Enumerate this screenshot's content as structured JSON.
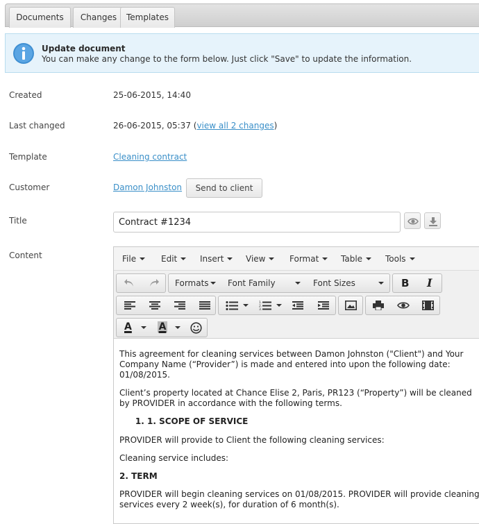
{
  "tabs": [
    {
      "label": "Documents"
    },
    {
      "label": "Changes"
    },
    {
      "label": "Templates"
    }
  ],
  "info": {
    "title": "Update document",
    "text": "You can make any change to the form below. Just click \"Save\" to update the information."
  },
  "fields": {
    "created_label": "Created",
    "created_value": "25-06-2015, 14:40",
    "last_changed_label": "Last changed",
    "last_changed_value": "26-06-2015, 05:37 (",
    "last_changed_link": "view all 2 changes",
    "last_changed_close": ")",
    "template_label": "Template",
    "template_link": "Cleaning contract",
    "customer_label": "Customer",
    "customer_link": "Damon Johnston",
    "send_button": "Send to client",
    "title_label": "Title",
    "title_value": "Contract #1234",
    "content_label": "Content"
  },
  "editor": {
    "menus": [
      "File",
      "Edit",
      "Insert",
      "View",
      "Format",
      "Table",
      "Tools"
    ],
    "formats_label": "Formats",
    "font_family_label": "Font Family",
    "font_sizes_label": "Font Sizes",
    "bold_glyph": "B",
    "italic_glyph": "I",
    "text_color_glyph": "A",
    "bg_color_glyph": "A",
    "content": {
      "p1": "This agreement for cleaning services between Damon Johnston (\"Client\") and Your Company Name (“Provider”) is made and entered into upon the following date: 01/08/2015.",
      "p2": "Client’s property located at Chance Elise 2, Paris, PR123 (“Property”) will be cleaned by PROVIDER in accordance with the following terms.",
      "li1": "1. SCOPE OF SERVICE",
      "p3": "PROVIDER will provide to Client the following cleaning services:",
      "p4": "Cleaning service includes:",
      "h2": "2. TERM",
      "p5": "PROVIDER will begin cleaning services on 01/08/2015. PROVIDER will provide cleaning services every 2 week(s), for duration of 6 month(s)."
    }
  },
  "colors": {
    "link": "#3a8fc8",
    "info_bg": "#e6f3fb",
    "info_icon": "#3f8fd2"
  }
}
